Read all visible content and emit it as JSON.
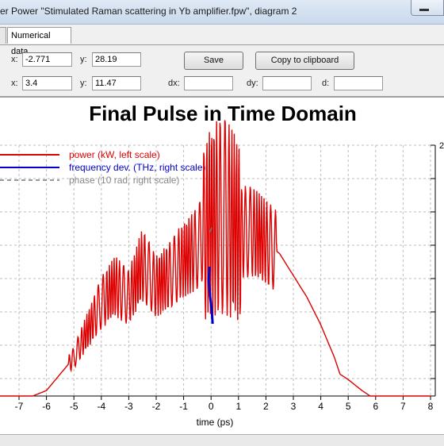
{
  "window": {
    "title": "er Power \"Stimulated Raman scattering in Yb amplifier.fpw\", diagram 2"
  },
  "tabs": [
    {
      "label": ""
    },
    {
      "label": "Numerical data"
    }
  ],
  "cursor": {
    "x1_label": "x:",
    "x1_value": "-2.771",
    "y1_label": "y:",
    "y1_value": "28.19",
    "x2_label": "x:",
    "x2_value": "3.4",
    "y2_label": "y:",
    "y2_value": "11.47",
    "dx_label": "dx:",
    "dx_value": "",
    "dy_label": "dy:",
    "dy_value": "",
    "d_label": "d:",
    "d_value": ""
  },
  "buttons": {
    "save": "Save",
    "copy": "Copy to clipboard"
  },
  "colors": {
    "power": "#dd0000",
    "frequency": "#0000cc",
    "phase": "#777777"
  },
  "chart_data": {
    "type": "line",
    "title": "Final Pulse in Time Domain",
    "xlabel": "time (ps)",
    "xlim": [
      -7.5,
      8
    ],
    "x_ticks": [
      "-7",
      "-6",
      "-5",
      "-4",
      "-3",
      "-2",
      "-1",
      "0",
      "1",
      "2",
      "3",
      "4",
      "5",
      "6",
      "7",
      "8"
    ],
    "right_ticks": [
      "2"
    ],
    "grid": true,
    "legend_position": "top-left",
    "series": [
      {
        "name": "power (kW, left scale)",
        "x": [
          -7.5,
          -6.5,
          -6.0,
          -5.5,
          -5.0,
          -4.5,
          -4.0,
          -3.5,
          -3.0,
          -2.5,
          -2.0,
          -1.5,
          -1.0,
          -0.5,
          0.0,
          0.5,
          1.0,
          1.5,
          2.0,
          2.5,
          3.0,
          3.5,
          4.0,
          4.5,
          4.7,
          5.0,
          5.5,
          5.8,
          6.5,
          8.0
        ],
        "values": [
          0,
          0,
          1,
          4,
          7,
          12,
          17,
          20,
          18,
          24,
          20,
          22,
          25,
          27,
          32,
          33,
          30,
          30,
          28,
          26,
          22,
          18,
          13,
          7,
          4,
          3,
          1,
          0,
          0,
          0
        ]
      },
      {
        "name": "frequency dev. (THz, right scale)"
      },
      {
        "name": "phase (10 rad, right scale)"
      }
    ]
  }
}
